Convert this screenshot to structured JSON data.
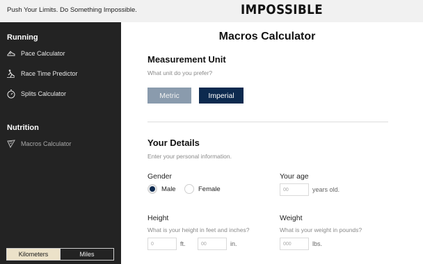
{
  "header": {
    "tagline": "Push Your Limits. Do Something Impossible.",
    "brand": "IMPOSSIBLE"
  },
  "sidebar": {
    "running_title": "Running",
    "running_items": [
      {
        "label": "Pace Calculator",
        "icon": "running-shoe-icon"
      },
      {
        "label": "Race Time Predictor",
        "icon": "runner-icon"
      },
      {
        "label": "Splits Calculator",
        "icon": "stopwatch-icon"
      }
    ],
    "nutrition_title": "Nutrition",
    "nutrition_items": [
      {
        "label": "Macros Calculator",
        "icon": "food-slice-icon",
        "active": true
      }
    ],
    "units": {
      "selected": "Kilometers",
      "other": "Miles"
    }
  },
  "main": {
    "title": "Macros Calculator",
    "measurement": {
      "heading": "Measurement Unit",
      "help": "What unit do you prefer?",
      "metric_label": "Metric",
      "imperial_label": "Imperial",
      "selected": "Imperial"
    },
    "details": {
      "heading": "Your Details",
      "help": "Enter your personal information.",
      "gender": {
        "label": "Gender",
        "options": [
          "Male",
          "Female"
        ],
        "selected": "Male"
      },
      "age": {
        "label": "Your age",
        "placeholder": "00",
        "unit": "years old."
      },
      "height": {
        "label": "Height",
        "help": "What is your height in feet and inches?",
        "feet_placeholder": "0",
        "feet_unit": "ft.",
        "inches_placeholder": "00",
        "inches_unit": "in."
      },
      "weight": {
        "label": "Weight",
        "help": "What is your weight in pounds?",
        "placeholder": "000",
        "unit": "lbs."
      }
    }
  },
  "colors": {
    "sidebar_bg": "#232323",
    "accent_navy": "#0d2a4f",
    "metric_button": "#8a9bad",
    "unit_toggle_selected": "#ece2c9"
  }
}
